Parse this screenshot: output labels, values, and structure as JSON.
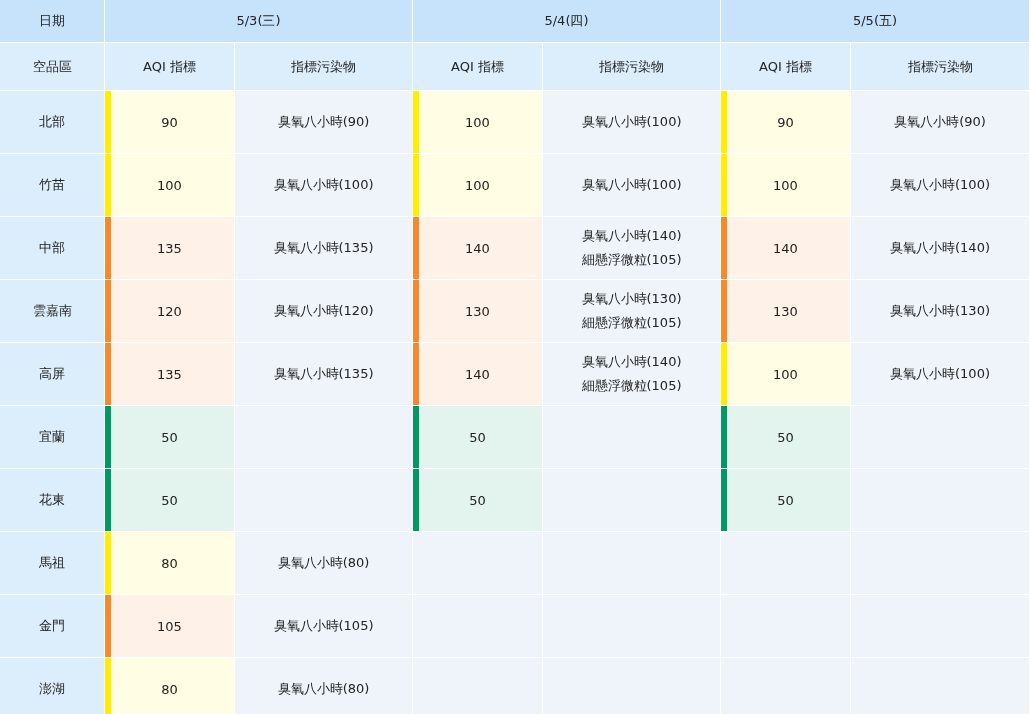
{
  "header": {
    "date_label": "日期",
    "region_label": "空品區",
    "dates": [
      {
        "date": "5/3(三)",
        "aqi_label": "AQI 指標",
        "pollutant_label": "指標污染物"
      },
      {
        "date": "5/4(四)",
        "aqi_label": "AQI 指標",
        "pollutant_label": "指標污染物"
      },
      {
        "date": "5/5(五)",
        "aqi_label": "AQI 指標",
        "pollutant_label": "指標污染物"
      }
    ]
  },
  "rows": [
    {
      "region": "北部",
      "days": [
        {
          "aqi": "90",
          "color": "#ffee00",
          "pollutants": [
            "臭氧八小時(90)"
          ]
        },
        {
          "aqi": "100",
          "color": "#ffee00",
          "pollutants": [
            "臭氧八小時(100)"
          ]
        },
        {
          "aqi": "90",
          "color": "#ffee00",
          "pollutants": [
            "臭氧八小時(90)"
          ]
        }
      ]
    },
    {
      "region": "竹苗",
      "days": [
        {
          "aqi": "100",
          "color": "#ffee00",
          "pollutants": [
            "臭氧八小時(100)"
          ]
        },
        {
          "aqi": "100",
          "color": "#ffee00",
          "pollutants": [
            "臭氧八小時(100)"
          ]
        },
        {
          "aqi": "100",
          "color": "#ffee00",
          "pollutants": [
            "臭氧八小時(100)"
          ]
        }
      ]
    },
    {
      "region": "中部",
      "days": [
        {
          "aqi": "135",
          "color": "#f5892b",
          "pollutants": [
            "臭氧八小時(135)"
          ]
        },
        {
          "aqi": "140",
          "color": "#f5892b",
          "pollutants": [
            "臭氧八小時(140)",
            "細懸浮微粒(105)"
          ]
        },
        {
          "aqi": "140",
          "color": "#f5892b",
          "pollutants": [
            "臭氧八小時(140)"
          ]
        }
      ]
    },
    {
      "region": "雲嘉南",
      "days": [
        {
          "aqi": "120",
          "color": "#f5892b",
          "pollutants": [
            "臭氧八小時(120)"
          ]
        },
        {
          "aqi": "130",
          "color": "#f5892b",
          "pollutants": [
            "臭氧八小時(130)",
            "細懸浮微粒(105)"
          ]
        },
        {
          "aqi": "130",
          "color": "#f5892b",
          "pollutants": [
            "臭氧八小時(130)"
          ]
        }
      ]
    },
    {
      "region": "高屏",
      "days": [
        {
          "aqi": "135",
          "color": "#f5892b",
          "pollutants": [
            "臭氧八小時(135)"
          ]
        },
        {
          "aqi": "140",
          "color": "#f5892b",
          "pollutants": [
            "臭氧八小時(140)",
            "細懸浮微粒(105)"
          ]
        },
        {
          "aqi": "100",
          "color": "#ffee00",
          "pollutants": [
            "臭氧八小時(100)"
          ]
        }
      ]
    },
    {
      "region": "宜蘭",
      "days": [
        {
          "aqi": "50",
          "color": "#009966"
        },
        {
          "aqi": "50",
          "color": "#009966"
        },
        {
          "aqi": "50",
          "color": "#009966"
        }
      ]
    },
    {
      "region": "花東",
      "days": [
        {
          "aqi": "50",
          "color": "#009966"
        },
        {
          "aqi": "50",
          "color": "#009966"
        },
        {
          "aqi": "50",
          "color": "#009966"
        }
      ]
    },
    {
      "region": "馬祖",
      "days": [
        {
          "aqi": "80",
          "color": "#ffee00",
          "pollutants": [
            "臭氧八小時(80)"
          ]
        }
      ]
    },
    {
      "region": "金門",
      "days": [
        {
          "aqi": "105",
          "color": "#f5892b",
          "pollutants": [
            "臭氧八小時(105)"
          ]
        }
      ]
    },
    {
      "region": "澎湖",
      "days": [
        {
          "aqi": "80",
          "color": "#ffee00",
          "pollutants": [
            "臭氧八小時(80)"
          ]
        }
      ]
    }
  ]
}
